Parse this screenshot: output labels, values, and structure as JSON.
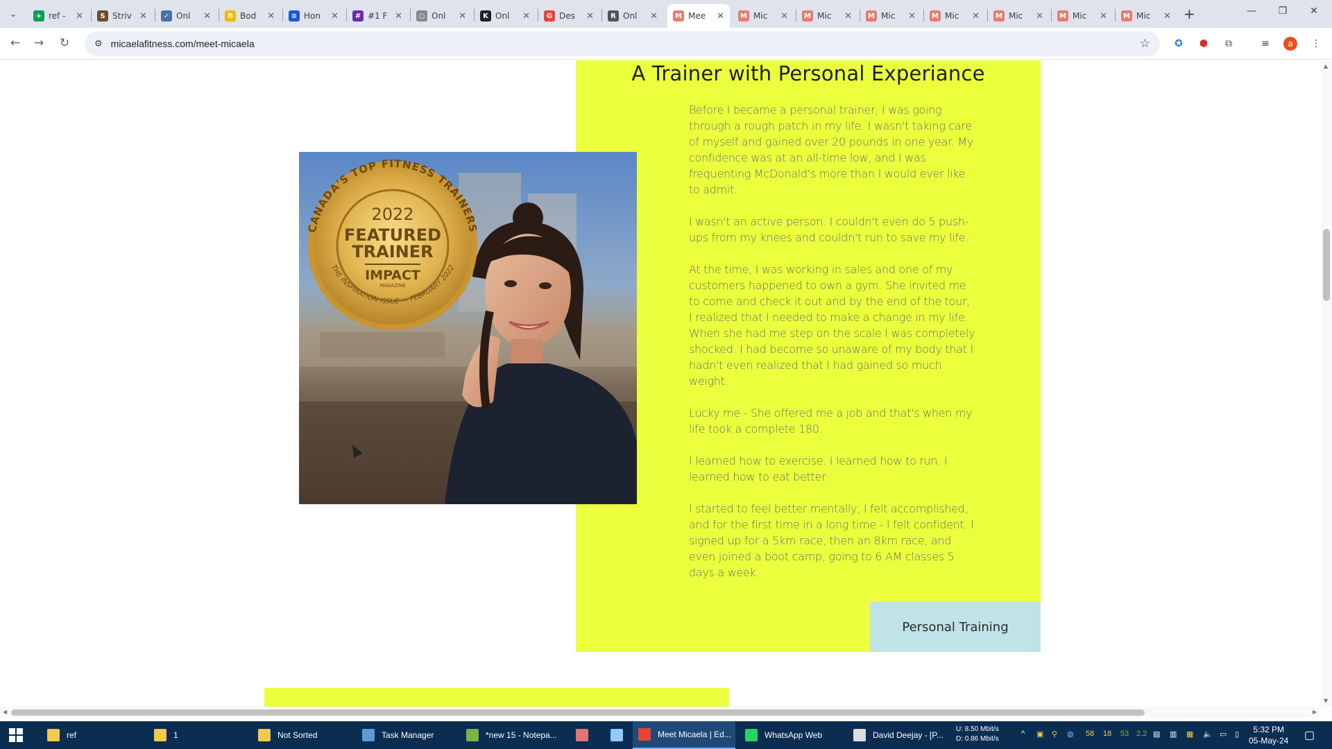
{
  "browser": {
    "tabs": [
      {
        "label": "ref -",
        "favicon": "sheets-icon",
        "color": "#0f9d58",
        "glyph": "+"
      },
      {
        "label": "Striv",
        "favicon": "striv-icon",
        "color": "#6b4f2c",
        "glyph": "S"
      },
      {
        "label": "Onl",
        "favicon": "check-icon",
        "color": "#4a6fa5",
        "glyph": "✓"
      },
      {
        "label": "Bod",
        "favicon": "bod-icon",
        "color": "#f2b705",
        "glyph": "B"
      },
      {
        "label": "Hon",
        "favicon": "stack-icon",
        "color": "#1a56db",
        "glyph": "≡"
      },
      {
        "label": "#1 F",
        "favicon": "shield-icon",
        "color": "#6c2ba8",
        "glyph": "#"
      },
      {
        "label": "Onl",
        "favicon": "circle-icon",
        "color": "#888888",
        "glyph": "○"
      },
      {
        "label": "Onl",
        "favicon": "k-icon",
        "color": "#222222",
        "glyph": "K"
      },
      {
        "label": "Des",
        "favicon": "g-icon",
        "color": "#ea4335",
        "glyph": "G"
      },
      {
        "label": "Onl",
        "favicon": "runner-icon",
        "color": "#555555",
        "glyph": "R"
      },
      {
        "label": "Mee",
        "favicon": "micaela-icon",
        "color": "#e67c73",
        "glyph": "M",
        "active": true
      },
      {
        "label": "Mic",
        "favicon": "micaela-icon",
        "color": "#e67c73",
        "glyph": "M"
      },
      {
        "label": "Mic",
        "favicon": "micaela-icon",
        "color": "#e67c73",
        "glyph": "M"
      },
      {
        "label": "Mic",
        "favicon": "micaela-icon",
        "color": "#e67c73",
        "glyph": "M"
      },
      {
        "label": "Mic",
        "favicon": "micaela-icon",
        "color": "#e67c73",
        "glyph": "M"
      },
      {
        "label": "Mic",
        "favicon": "micaela-icon",
        "color": "#e67c73",
        "glyph": "M"
      },
      {
        "label": "Mic",
        "favicon": "micaela-icon",
        "color": "#e67c73",
        "glyph": "M"
      },
      {
        "label": "Mic",
        "favicon": "micaela-icon",
        "color": "#e67c73",
        "glyph": "M"
      }
    ],
    "url": "micaelafitness.com/meet-micaela",
    "profile_initial": "a"
  },
  "page": {
    "title": "A Trainer with Personal Experiance",
    "paragraphs": [
      "Before I became a personal trainer, I was going through a rough patch in my life. I wasn't taking care of myself and gained over 20 pounds in one year. My confidence was at an all-time low, and I was frequenting McDonald's more than I would ever like to admit.",
      "I wasn't an active person. I couldn't even do 5 push-ups from my knees and couldn't run to save my life.",
      "At the time, I was working in sales and one of my customers happened to own a gym. She invited me to come and check it out and by the end of the tour, I realized that I needed to make a change in my life. When she had me step on the scale I was completely shocked. I had become so unaware of my body that I hadn't even realized that I had gained so much weight.",
      "Lucky me - She offered me a job and that's when my life took a complete 180.",
      "I learned how to exercise. I learned how to run. I learned how to eat better.",
      "I started to feel better mentally, I felt accomplished, and for the first time in a long time - I felt confident. I signed up for a 5km race, then an 8km race, and even joined a boot camp, going to 6 AM classes 5 days a week."
    ],
    "cta_label": "Personal Training",
    "badge": {
      "ring_top": "CANADA'S TOP FITNESS TRAINERS",
      "ring_bottom": "THE INSPIRATION ISSUE — FEBRUARY 2022",
      "year": "2022",
      "line1": "FEATURED",
      "line2": "TRAINER",
      "brand": "IMPACT",
      "brand_sub": "MAGAZINE"
    },
    "accent_yellow": "#ebff3d",
    "cta_color": "#bfe3e6"
  },
  "taskbar": {
    "items": [
      {
        "label": "ref",
        "icon": "folder-icon",
        "color": "#f2c94c"
      },
      {
        "label": "1",
        "icon": "folder-icon",
        "color": "#f2c94c"
      },
      {
        "label": "Not Sorted",
        "icon": "folder-icon",
        "color": "#f2c94c"
      },
      {
        "label": "Task Manager",
        "icon": "task-manager-icon",
        "color": "#5b9bd5"
      },
      {
        "label": "*new 15 - Notepa...",
        "icon": "notepad-icon",
        "color": "#7cb342"
      },
      {
        "label": "",
        "icon": "app-icon",
        "color": "#e57373"
      },
      {
        "label": "",
        "icon": "document-icon",
        "color": "#90caf9"
      },
      {
        "label": "Meet Micaela | Ed...",
        "icon": "chrome-icon",
        "color": "#ea4335",
        "active": true
      },
      {
        "label": "WhatsApp Web",
        "icon": "whatsapp-icon",
        "color": "#25d366"
      },
      {
        "label": "David Deejay - [P...",
        "icon": "media-icon",
        "color": "#dddddd"
      }
    ],
    "net_up": "U:  8.50 Mbit/s",
    "net_down": "D:  0.86 Mbit/s",
    "tray_numbers": [
      "58",
      "18",
      "53",
      "2.2"
    ],
    "time": "5:32 PM",
    "date": "05-May-24"
  }
}
